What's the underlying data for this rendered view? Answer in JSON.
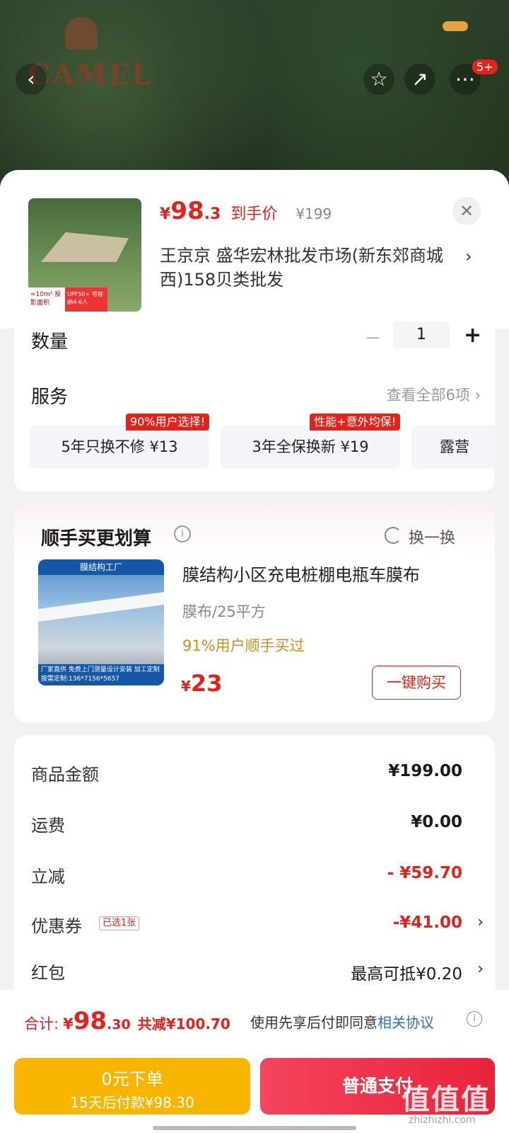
{
  "hero": {
    "brand_text": "CAMEL",
    "notification_count": "5+"
  },
  "product": {
    "price_currency": "¥",
    "price_integer": "98",
    "price_decimal": ".3",
    "price_label": "到手价",
    "original_price": "¥199",
    "close_glyph": "✕",
    "address": "王京京  盛华宏林批发市场(新东郊商城西)158贝类批发",
    "thumb_tags": [
      "≈10m² 投影面积",
      "UPF50+ 可容纳4-6人"
    ]
  },
  "quantity": {
    "label": "数量",
    "value": "1",
    "minus": "−",
    "plus": "+"
  },
  "service": {
    "label": "服务",
    "view_all": "查看全部6项 ›",
    "chips": [
      {
        "label": "5年只换不修  ¥13",
        "hot": "90%用户选择!"
      },
      {
        "label": "3年全保换新  ¥19",
        "hot": "性能+意外均保!"
      },
      {
        "label": "露营",
        "hot": ""
      }
    ]
  },
  "bundle": {
    "title": "顺手买更划算",
    "refresh": "换一换",
    "image_header": "膜结构工厂",
    "image_footer": "厂家直供 免费上门测量设计安装 加工定制 按需定制:136*7156*5657",
    "name": "膜结构小区充电桩棚电瓶车膜布",
    "spec": "膜布/25平方",
    "stat": "91%用户顺手买过",
    "price_currency": "¥",
    "price_integer": "23",
    "buy_button": "一键购买"
  },
  "summary": {
    "rows": [
      {
        "key": "商品金额",
        "value": "¥199.00",
        "tag": ""
      },
      {
        "key": "运费",
        "value": "¥0.00",
        "tag": ""
      },
      {
        "key": "立减",
        "value": "- ¥59.70",
        "tag": ""
      },
      {
        "key": "优惠券",
        "value": "-¥41.00",
        "tag": "已选1张"
      },
      {
        "key": "红包",
        "value": "最高可抵¥0.20",
        "tag": ""
      }
    ]
  },
  "bottom": {
    "total_label": "合计:",
    "total_currency": "¥",
    "total_integer": "98",
    "total_decimal": ".30",
    "total_saved": "共减¥100.70",
    "agree_text": "使用先享后付即同意",
    "agree_link": "相关协议",
    "later_line1": "0元下单",
    "later_line2": "15天后付款¥98.30",
    "pay_button": "普通支付"
  },
  "watermark": {
    "main": "值值值",
    "sub": "zhizhizhi.com"
  },
  "colors": {
    "accent_red": "#e2231a",
    "later_yellow": "#f7b500",
    "pay_red": "#e8233a",
    "link_blue": "#2a6fd6"
  }
}
